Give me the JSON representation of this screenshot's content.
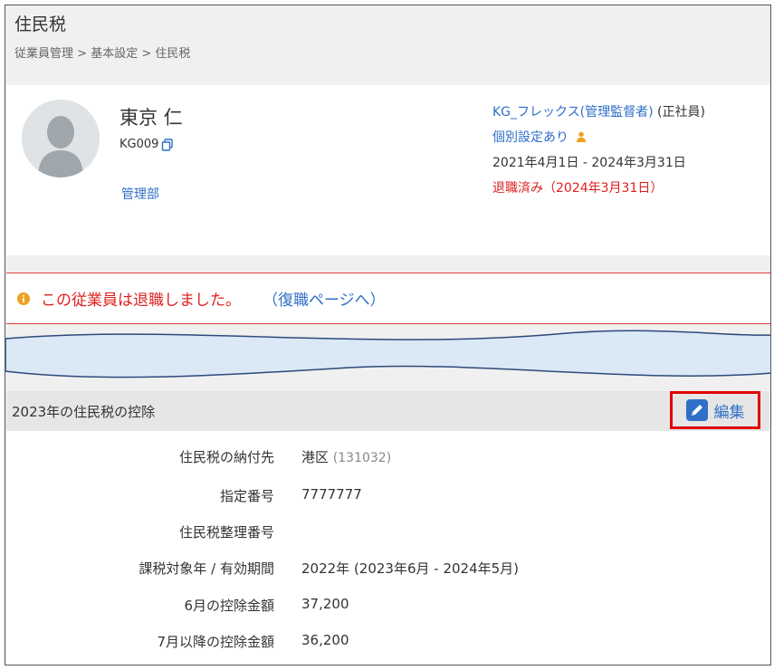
{
  "page": {
    "title": "住民税",
    "breadcrumb": [
      "従業員管理",
      "基本設定",
      "住民税"
    ],
    "breadcrumb_separator": " > "
  },
  "employee": {
    "name": "東京 仁",
    "code": "KG009",
    "department": "管理部",
    "work_rule_link": "KG_フレックス(管理監督者)",
    "employment_type": " (正社員)",
    "individual_setting": "個別設定あり",
    "period": "2021年4月1日 - 2024年3月31日",
    "status": "退職済み（2024年3月31日）"
  },
  "alert": {
    "message": "この従業員は退職しました。",
    "link": "（復職ページへ）"
  },
  "section": {
    "title": "2023年の住民税の控除",
    "edit_label": "編集"
  },
  "details": [
    {
      "label": "住民税の納付先",
      "value": "港区",
      "sub": "(131032)"
    },
    {
      "label": "指定番号",
      "value": "7777777",
      "sub": ""
    },
    {
      "label": "住民税整理番号",
      "value": "",
      "sub": ""
    },
    {
      "label": "課税対象年 / 有効期間",
      "value": "2022年 (2023年6月 - 2024年5月)",
      "sub": ""
    },
    {
      "label": "6月の控除金額",
      "value": "37,200",
      "sub": ""
    },
    {
      "label": "7月以降の控除金額",
      "value": "36,200",
      "sub": ""
    }
  ],
  "colors": {
    "link": "#2f6fc6",
    "alert": "#e02020",
    "highlight_box": "#e00000",
    "person_icon": "#f0a020",
    "info_icon": "#f0a020"
  },
  "icons": [
    "copy-icon",
    "person-icon",
    "info-icon",
    "edit-icon",
    "avatar-placeholder"
  ]
}
